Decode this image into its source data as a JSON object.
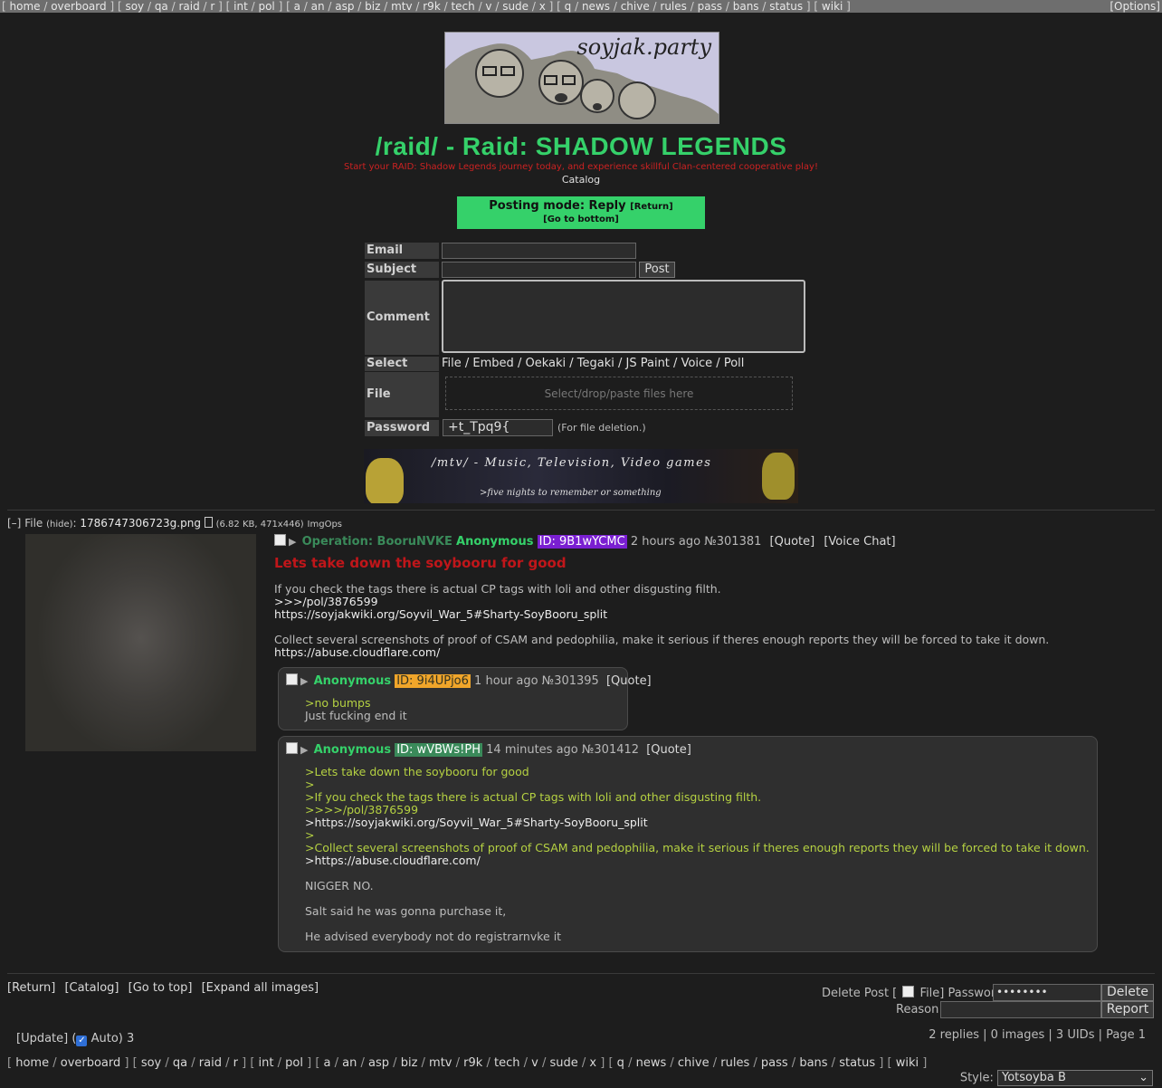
{
  "top_nav": {
    "groups": [
      [
        "home",
        "overboard"
      ],
      [
        "soy",
        "qa",
        "raid",
        "r"
      ],
      [
        "int",
        "pol"
      ],
      [
        "a",
        "an",
        "asp",
        "biz",
        "mtv",
        "r9k",
        "tech",
        "v",
        "sude",
        "x"
      ],
      [
        "q",
        "news",
        "chive",
        "rules",
        "pass",
        "bans",
        "status"
      ],
      [
        "wiki"
      ]
    ],
    "options_label": "[Options]"
  },
  "banner": {
    "logo_text": "soyjak.party"
  },
  "board": {
    "title": "/raid/ - Raid: SHADOW LEGENDS",
    "subtitle": "Start your RAID: Shadow Legends journey today, and experience skillful Clan-centered cooperative play!",
    "catalog_label": "Catalog"
  },
  "posting_mode": {
    "label": "Posting mode: Reply",
    "return_label": "[Return]",
    "bottom_label": "[Go to bottom]"
  },
  "form": {
    "email_label": "Email",
    "subject_label": "Subject",
    "post_button": "Post",
    "comment_label": "Comment",
    "select_label": "Select",
    "select_options": [
      "File",
      "Embed",
      "Oekaki",
      "Tegaki",
      "JS Paint",
      "Voice",
      "Poll"
    ],
    "file_label": "File",
    "dropzone_text": "Select/drop/paste files here",
    "password_label": "Password",
    "password_value": "+t_Tpq9{",
    "password_note": "(For file deletion.)"
  },
  "ad": {
    "title": "/mtv/ - Music, Television, Video games",
    "tagline": ">five nights to remember or something"
  },
  "op": {
    "file_toggle": "[–]",
    "file_prefix": "File",
    "file_hide": "(hide)",
    "filename": "1786747306723g.png",
    "file_icon": "doc-icon",
    "file_meta": "(6.82 KB, 471x446)",
    "imgops": "ImgOps",
    "tripcode": "Operation: BooruNVKE",
    "name": "Anonymous",
    "uid": "ID: 9B1wYCMC",
    "time": "2 hours ago",
    "post_no": "№301381",
    "quote_label": "[Quote]",
    "voice_label": "[Voice Chat]",
    "subject": "Lets take down the soybooru for good",
    "lines": [
      "If you check the tags there is actual CP tags with loli and other disgusting filth.",
      ">>>/pol/3876599",
      "https://soyjakwiki.org/Soyvil_War_5#Sharty-SoyBooru_split",
      "Collect several screenshots of proof of CSAM and pedophilia, make it serious if theres enough reports they will be forced to take it down.",
      "https://abuse.cloudflare.com/"
    ]
  },
  "replies": [
    {
      "name": "Anonymous",
      "uid": "ID: 9i4UPjo6",
      "time": "1 hour ago",
      "post_no": "№301395",
      "quote_label": "[Quote]",
      "lines": [
        ">no bumps",
        "Just fucking end it"
      ]
    },
    {
      "name": "Anonymous",
      "uid": "ID: wVBWs!PH",
      "time": "14 minutes ago",
      "post_no": "№301412",
      "quote_label": "[Quote]",
      "lines": [
        ">Lets take down the soybooru for good",
        ">",
        ">If you check the tags there is actual CP tags with loli and other disgusting filth.",
        ">>>>/pol/3876599",
        ">https://soyjakwiki.org/Soyvil_War_5#Sharty-SoyBooru_split",
        ">",
        ">Collect several screenshots of proof of CSAM and pedophilia, make it serious if theres enough reports they will be forced to take it down.",
        ">https://abuse.cloudflare.com/",
        "NIGGER NO.",
        "Salt said he was gonna purchase it,",
        "He advised everybody not do registrarnvke it"
      ]
    }
  ],
  "footer": {
    "links": [
      "[Return]",
      "[Catalog]",
      "[Go to top]",
      "[Expand all images]"
    ],
    "delete_post_prefix": "Delete Post [",
    "file_label": "File]",
    "password_label": "Password",
    "password_value": "••••••••",
    "delete_button": "Delete",
    "reason_label": "Reason",
    "report_button": "Report",
    "update_label": "[Update]",
    "auto_open": "(",
    "auto_label": "Auto)",
    "auto_count": "3",
    "stats": "2 replies | 0 images | 3 UIDs | Page 1",
    "style_label": "Style:",
    "style_value": "Yotsoyba B"
  }
}
